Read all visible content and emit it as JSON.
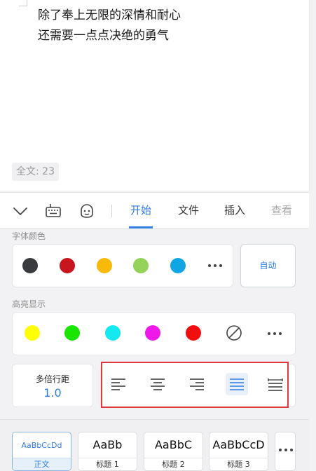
{
  "document": {
    "lines": [
      "除了奉上无限的深情和耐心",
      "还需要一点点决绝的勇气"
    ],
    "word_count": "全文: 23"
  },
  "toolbar": {
    "icons": [
      "chevron-down-icon",
      "keyboard-icon",
      "emoji-icon"
    ],
    "tabs": [
      {
        "label": "开始",
        "active": true
      },
      {
        "label": "文件",
        "active": false
      },
      {
        "label": "插入",
        "active": false
      },
      {
        "label": "查看",
        "active": false
      }
    ]
  },
  "font_color": {
    "label": "字体颜色",
    "colors": [
      "#3a3b3f",
      "#c9151e",
      "#f9b908",
      "#95d25a",
      "#12a5e4"
    ],
    "auto_label": "自动"
  },
  "highlight": {
    "label": "高亮显示",
    "colors": [
      "#ffff00",
      "#18e600",
      "#16e8f0",
      "#f018e8",
      "#f00e0e"
    ]
  },
  "line_spacing": {
    "label": "多倍行距",
    "value": "1.0"
  },
  "alignment": {
    "options": [
      "align-left",
      "align-center",
      "align-right",
      "align-justify",
      "align-distributed"
    ],
    "selected": "align-justify"
  },
  "styles": [
    {
      "sample": "AaBbCcDd",
      "caption": "正文",
      "selected": true
    },
    {
      "sample": "AaBb",
      "caption": "标题 1",
      "selected": false
    },
    {
      "sample": "AaBbC",
      "caption": "标题 2",
      "selected": false
    },
    {
      "sample": "AaBbCcD",
      "caption": "标题 3",
      "selected": false
    }
  ]
}
